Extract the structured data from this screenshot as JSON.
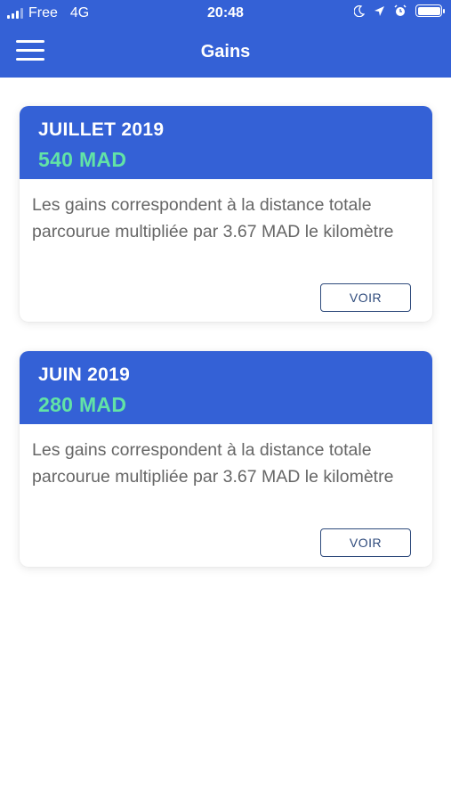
{
  "status_bar": {
    "carrier": "Free",
    "network": "4G",
    "time": "20:48",
    "icons": [
      "moon-icon",
      "location-arrow-icon",
      "alarm-icon",
      "battery-icon"
    ]
  },
  "header": {
    "title": "Gains",
    "menu_icon": "hamburger-menu-icon",
    "background": "#3461d6"
  },
  "cards": [
    {
      "month": "JUILLET 2019",
      "amount": "540 MAD",
      "description": "Les gains correspondent à la distance totale parcourue multipliée par 3.67 MAD le kilomètre",
      "button_label": "VOIR"
    },
    {
      "month": "JUIN 2019",
      "amount": "280 MAD",
      "description": "Les gains correspondent à la distance totale parcourue multipliée par 3.67 MAD le kilomètre",
      "button_label": "VOIR"
    }
  ],
  "colors": {
    "primary": "#3461d6",
    "amount": "#62e3a6",
    "button_border": "#2f4b7c",
    "text": "#666666"
  }
}
